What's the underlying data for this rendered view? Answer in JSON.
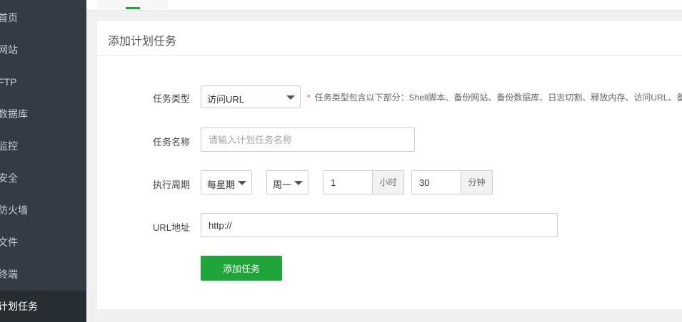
{
  "sidebar": {
    "items": [
      {
        "label": "首页"
      },
      {
        "label": "网站"
      },
      {
        "label": "FTP"
      },
      {
        "label": "数据库"
      },
      {
        "label": "监控"
      },
      {
        "label": "安全"
      },
      {
        "label": "防火墙"
      },
      {
        "label": "文件"
      },
      {
        "label": "终端"
      },
      {
        "label": "计划任务",
        "active": true
      }
    ]
  },
  "colors": {
    "sidebar_bg": "#333c44",
    "sidebar_active_bg": "#262d33",
    "accent_green": "#20a53a",
    "required_star": "#e64545"
  },
  "panel": {
    "title": "添加计划任务"
  },
  "form": {
    "task_type": {
      "label": "任务类型",
      "selected": "访问URL",
      "hint_star": "*",
      "hint": "任务类型包含以下部分：Shell脚本、备份网站、备份数据库、日志切割、释放内存、访问URL、备"
    },
    "task_name": {
      "label": "任务名称",
      "placeholder": "请输入计划任务名称",
      "value": ""
    },
    "period": {
      "label": "执行周期",
      "cycle_selected": "每星期",
      "weekday_selected": "周一",
      "hour_value": "1",
      "hour_unit": "小时",
      "minute_value": "30",
      "minute_unit": "分钟"
    },
    "url": {
      "label": "URL地址",
      "value": "http://"
    },
    "submit_label": "添加任务"
  }
}
